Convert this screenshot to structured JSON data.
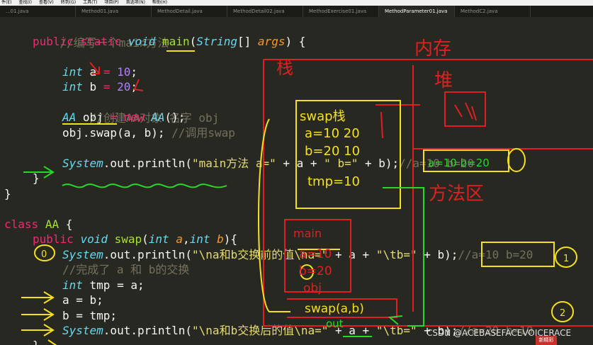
{
  "menubar": {
    "items": [
      "件(E)",
      "查找(I)",
      "查看(V)",
      "转到(G)",
      "工具(T)",
      "项目(P)",
      "首选项(N)",
      "帮助(H)"
    ]
  },
  "tabs": [
    {
      "label": "...01.java",
      "active": false
    },
    {
      "label": "Method01.java",
      "active": false
    },
    {
      "label": "MethodDetail.java",
      "active": false
    },
    {
      "label": "MethodDetail02.java",
      "active": false
    },
    {
      "label": "MethodExercise01.java",
      "active": false
    },
    {
      "label": "MethodParameter01.java",
      "active": true
    },
    {
      "label": "MethodC2.java",
      "active": false
    },
    {
      "label": "",
      "active": false
    }
  ],
  "code": {
    "l1": "//编写一个main方法",
    "l2": {
      "kw1": "public",
      "kw2": "static",
      "kw3": "void",
      "name": "main",
      "p1": "(",
      "type": "String",
      "p2": "[] ",
      "arg": "args",
      "p3": ") {"
    },
    "l4": {
      "type": "int",
      "var": "a",
      "eq": " = ",
      "num": "10",
      "end": ";"
    },
    "l5": {
      "type": "int",
      "var": "b",
      "eq": " = ",
      "num": "20",
      "end": ";"
    },
    "l6": "//创建AA对象 名字 obj",
    "l7": {
      "type1": "AA",
      "var": "obj",
      "eq": " = ",
      "new": "new",
      "type2": "AA",
      "end": "();"
    },
    "l8": {
      "code": "obj.swap(a, b); ",
      "comment": "//调用swap"
    },
    "l9": {
      "sys": "System",
      "dot": ".out.println(",
      "s1": "\"main方法 a=\"",
      "p1": " + a + ",
      "s2": "\" b=\"",
      "p2": " + b);",
      "comment": "//a=10 b=20"
    },
    "l10": "}",
    "l11": "}",
    "l12": {
      "kw": "class",
      "name": "AA",
      "end": " {"
    },
    "l13": {
      "kw1": "public",
      "kw2": "void",
      "name": "swap",
      "p1": "(",
      "t1": "int",
      "a1": "a",
      "c": ",",
      "t2": "int",
      "a2": "b",
      "p2": "){"
    },
    "l14": {
      "sys": "System",
      "dot": ".out.println(",
      "s1": "\"\\na和b交换前的值\\na=\"",
      "p1": " + a + ",
      "s2": "\"\\tb=\"",
      "p2": " + b);",
      "comment": "//a=10 b=20"
    },
    "l15": "//完成了 a 和 b的交换",
    "l16": {
      "type": "int",
      "rest": " tmp = a;"
    },
    "l17": "a = b;",
    "l18": "b = tmp;",
    "l19": {
      "sys": "System",
      "dot": ".out.println(",
      "s1": "\"\\na和b交换后的值\\na=\"",
      "p1": " + a + ",
      "s2": "\"\\tb=\"",
      "p2": " + b);",
      "comment": "//a=20 b=10"
    },
    "l20": "}"
  },
  "annotations": {
    "memory": "内存",
    "stack": "栈",
    "heap": "堆",
    "swap_frame": "swap栈",
    "swap_a": "a=10 20",
    "swap_b": "b=20 10",
    "swap_tmp": "tmp=10",
    "method_area": "方法区",
    "main_frame": "main",
    "main_a": "a=10",
    "main_b": "b=20",
    "main_obj": "obj",
    "call": "swap(a,b)",
    "out": "out",
    "note_main": "a=10 b=20",
    "circle0": "0",
    "circle1": "1",
    "circle2": "2"
  },
  "watermark": "CSDN @ACEBASEFACEVOICERACE",
  "badge": "新精彩"
}
